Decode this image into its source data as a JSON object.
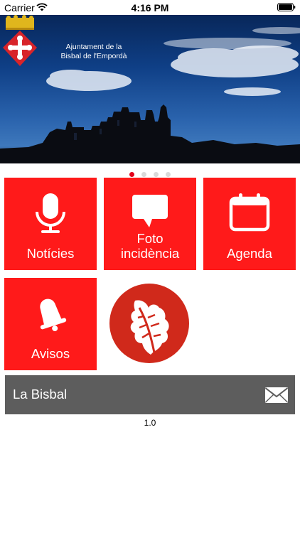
{
  "statusbar": {
    "carrier": "Carrier",
    "time": "4:16 PM",
    "icons": [
      "wifi-icon",
      "battery-icon"
    ]
  },
  "banner": {
    "title_line1": "Ajuntament de la",
    "title_line2": "Bisbal de l'Empordà",
    "carousel_pages": 4,
    "carousel_active": 1
  },
  "tiles": [
    {
      "label": "Notícies",
      "icon": "microphone-icon"
    },
    {
      "label_line1": "Foto",
      "label_line2": "incidència",
      "icon": "chat-bubble-icon"
    },
    {
      "label": "Agenda",
      "icon": "calendar-icon"
    },
    {
      "label": "Avisos",
      "icon": "bell-icon"
    }
  ],
  "logo": {
    "icon": "oak-leaf-logo"
  },
  "bar": {
    "title": "La Bisbal",
    "icon": "mail-icon"
  },
  "version": "1.0",
  "colors": {
    "tile_red": "#ff1a1a",
    "dot_active": "#e3001b",
    "dot_inactive": "#d9d9d9",
    "bar_gray": "#5d5d5d",
    "logo_red": "#d0291b"
  }
}
